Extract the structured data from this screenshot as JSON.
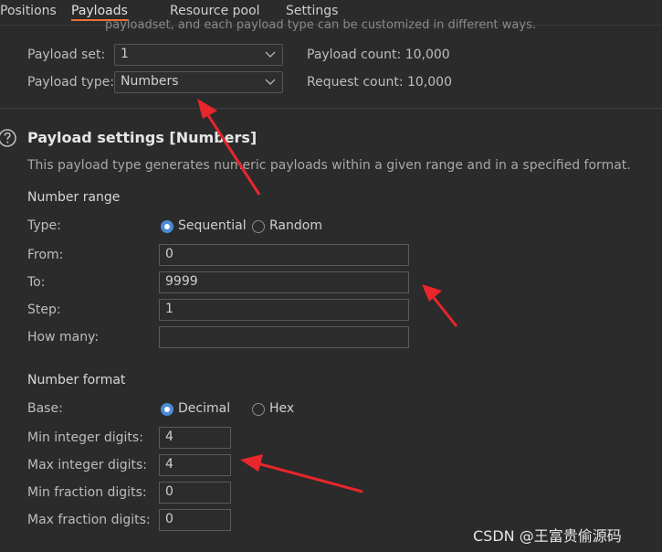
{
  "tabs": [
    {
      "label": "Positions"
    },
    {
      "label": "Payloads"
    },
    {
      "label": "Resource pool"
    },
    {
      "label": "Settings"
    }
  ],
  "cutoff_text": "payloadset, and each payload type can be customized in different ways.",
  "payload_set": {
    "label": "Payload set:",
    "value": "1"
  },
  "payload_type": {
    "label": "Payload type:",
    "value": "Numbers"
  },
  "payload_count": "Payload count: 10,000",
  "request_count": "Request count: 10,000",
  "settings": {
    "title": "Payload settings [Numbers]",
    "description": "This payload type generates numeric payloads within a given range and in a specified format."
  },
  "number_range": {
    "heading": "Number range",
    "type_label": "Type:",
    "type_options": [
      "Sequential",
      "Random"
    ],
    "type_selected": "Sequential",
    "from_label": "From:",
    "from_value": "0",
    "to_label": "To:",
    "to_value": "9999",
    "step_label": "Step:",
    "step_value": "1",
    "how_many_label": "How many:",
    "how_many_value": ""
  },
  "number_format": {
    "heading": "Number format",
    "base_label": "Base:",
    "base_options": [
      "Decimal",
      "Hex"
    ],
    "base_selected": "Decimal",
    "min_int_label": "Min integer digits:",
    "min_int_value": "4",
    "max_int_label": "Max integer digits:",
    "max_int_value": "4",
    "min_frac_label": "Min fraction digits:",
    "min_frac_value": "0",
    "max_frac_label": "Max fraction digits:",
    "max_frac_value": "0"
  },
  "watermark": "CSDN @王富贵偷源码",
  "colors": {
    "background": "#2b2b2c",
    "active_tab_underline": "#e8703a",
    "radio_selected": "#4b8bd4",
    "annotation_arrow": "#e8262b"
  }
}
